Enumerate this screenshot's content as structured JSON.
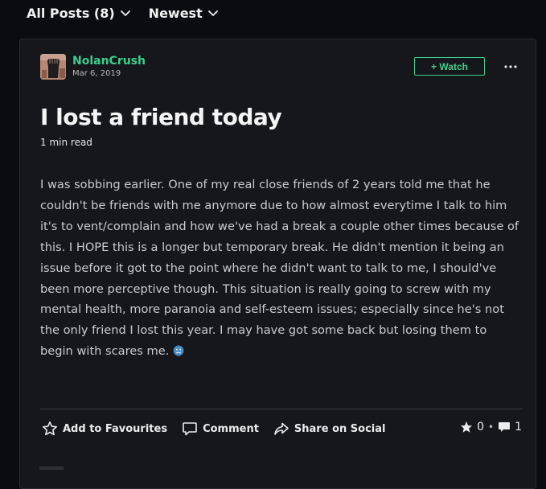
{
  "filters": {
    "posts_label": "All Posts (8)",
    "sort_label": "Newest"
  },
  "post": {
    "author": "NolanCrush",
    "date": "Mar 6, 2019",
    "watch_label": "+ Watch",
    "title": "I lost a friend today",
    "read_time": "1 min read",
    "body": "I was sobbing earlier. One of my real close friends of 2 years told me that he couldn't be friends with me anymore due to how almost everytime I talk to him it's to vent/complain and how we've had a break a couple other times because of this. I HOPE this is a longer but temporary break. He didn't mention it being an issue before it got to the point where he didn't want to talk to me, I should've been more perceptive though. This situation is really going to screw with my mental health, more paranoia and self-esteem issues; especially since he's not the only friend I lost this year. I may have got some back but losing them to begin with scares me.",
    "actions": {
      "favourite_label": "Add to Favourites",
      "comment_label": "Comment",
      "share_label": "Share on Social"
    },
    "counts": {
      "favourites": "0",
      "comments": "1"
    }
  },
  "colors": {
    "accent": "#3ecf8e",
    "background": "#0b0c0f",
    "card": "#16171b"
  },
  "icons": {
    "sort": "chevron-down-icon",
    "more": "more-dots-icon",
    "favourite": "star-outline-icon",
    "comment": "speech-bubble-icon",
    "share": "share-arrow-icon",
    "count_star": "star-filled-icon",
    "count_comment": "comment-filled-icon",
    "emoji": "sad-face-emoji-icon"
  }
}
